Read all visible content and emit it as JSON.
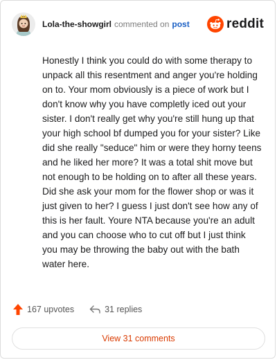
{
  "header": {
    "username": "Lola-the-showgirl",
    "action_text": "commented on",
    "target_text": "post",
    "brand_name": "reddit"
  },
  "comment": {
    "body": "Honestly I think you could do with some therapy to unpack all this resentment and anger you're holding on to. Your mom obviously is a piece of work but I don't know why you have completly iced out your sister. I don't really get why you're still hung up that your high school bf dumped you for your sister? Like did she really \"seduce\" him or were they horny teens and he liked her more? It was a total shit move but not enough to be holding on to after all these years. Did she ask your mom for the flower shop or was it just given to her? I guess I just don't see how any of this is her fault. Youre NTA because you're an adult and you can choose who to cut off but I just think you may be throwing the baby out with the bath water here."
  },
  "actions": {
    "upvotes_label": "167 upvotes",
    "replies_label": "31 replies",
    "upvote_icon": "upvote-arrow-icon",
    "reply_icon": "reply-arrow-icon"
  },
  "view_button": {
    "label": "View 31 comments"
  },
  "colors": {
    "brand_orange": "#ff4500",
    "link_blue": "#1a5fc4",
    "view_button_text": "#d93a00",
    "muted_text": "#7c7c7c"
  }
}
